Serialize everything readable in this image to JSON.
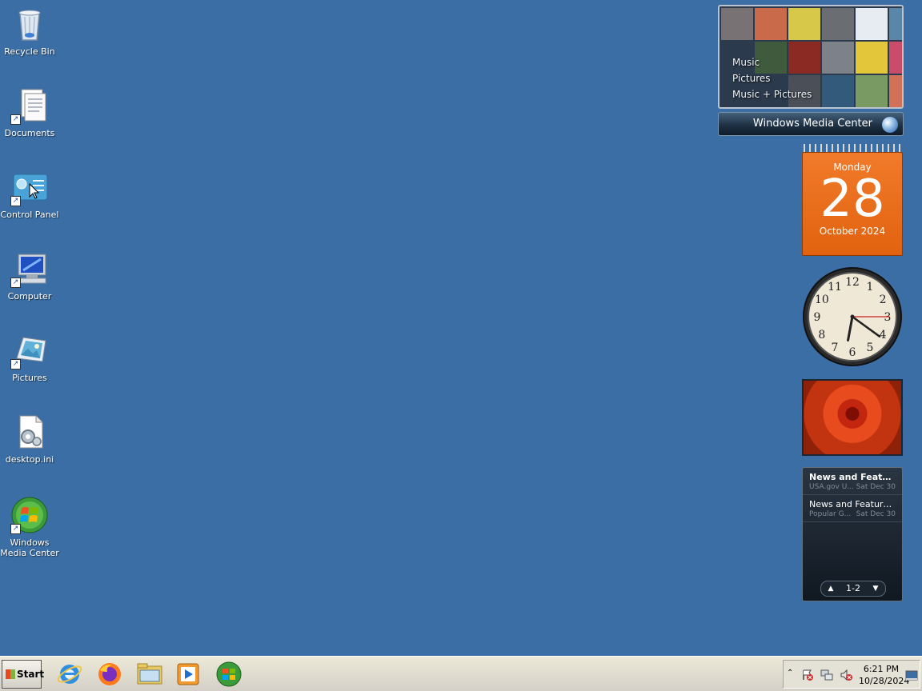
{
  "desktop_icons": [
    {
      "label": "Recycle Bin",
      "icon": "recycle-bin-icon"
    },
    {
      "label": "Documents",
      "icon": "documents-icon"
    },
    {
      "label": "Control Panel",
      "icon": "control-panel-icon"
    },
    {
      "label": "Computer",
      "icon": "computer-icon"
    },
    {
      "label": "Pictures",
      "icon": "pictures-icon"
    },
    {
      "label": "desktop.ini",
      "icon": "settings-file-icon"
    },
    {
      "label_line1": "Windows",
      "label_line2": "Media Center",
      "icon": "windows-media-center-icon"
    }
  ],
  "media_center": {
    "menu": [
      "Music",
      "Pictures",
      "Music + Pictures"
    ],
    "bar_label": "Windows Media Center"
  },
  "calendar": {
    "weekday": "Monday",
    "day": "28",
    "month_year": "October 2024"
  },
  "clock": {
    "numerals": [
      "12",
      "1",
      "2",
      "3",
      "4",
      "5",
      "6",
      "7",
      "8",
      "9",
      "10",
      "11"
    ],
    "hour": 6,
    "minute": 21,
    "second": 15
  },
  "feeds": {
    "items": [
      {
        "title": "News and Features f...",
        "source": "USA.gov U...",
        "date": "Sat Dec 30",
        "bold": true
      },
      {
        "title": "News and Feature...",
        "source": "Popular G...",
        "date": "Sat Dec 30",
        "bold": false
      }
    ],
    "page": "1-2"
  },
  "taskbar": {
    "start_label": "Start",
    "pinned": [
      "internet-explorer-icon",
      "firefox-icon",
      "file-explorer-icon",
      "media-player-icon",
      "windows-orb-icon"
    ],
    "time": "6:21 PM",
    "date": "10/28/2024"
  },
  "colors": {
    "desktop": "#3a6ea5",
    "calendar": "#e8681a"
  }
}
